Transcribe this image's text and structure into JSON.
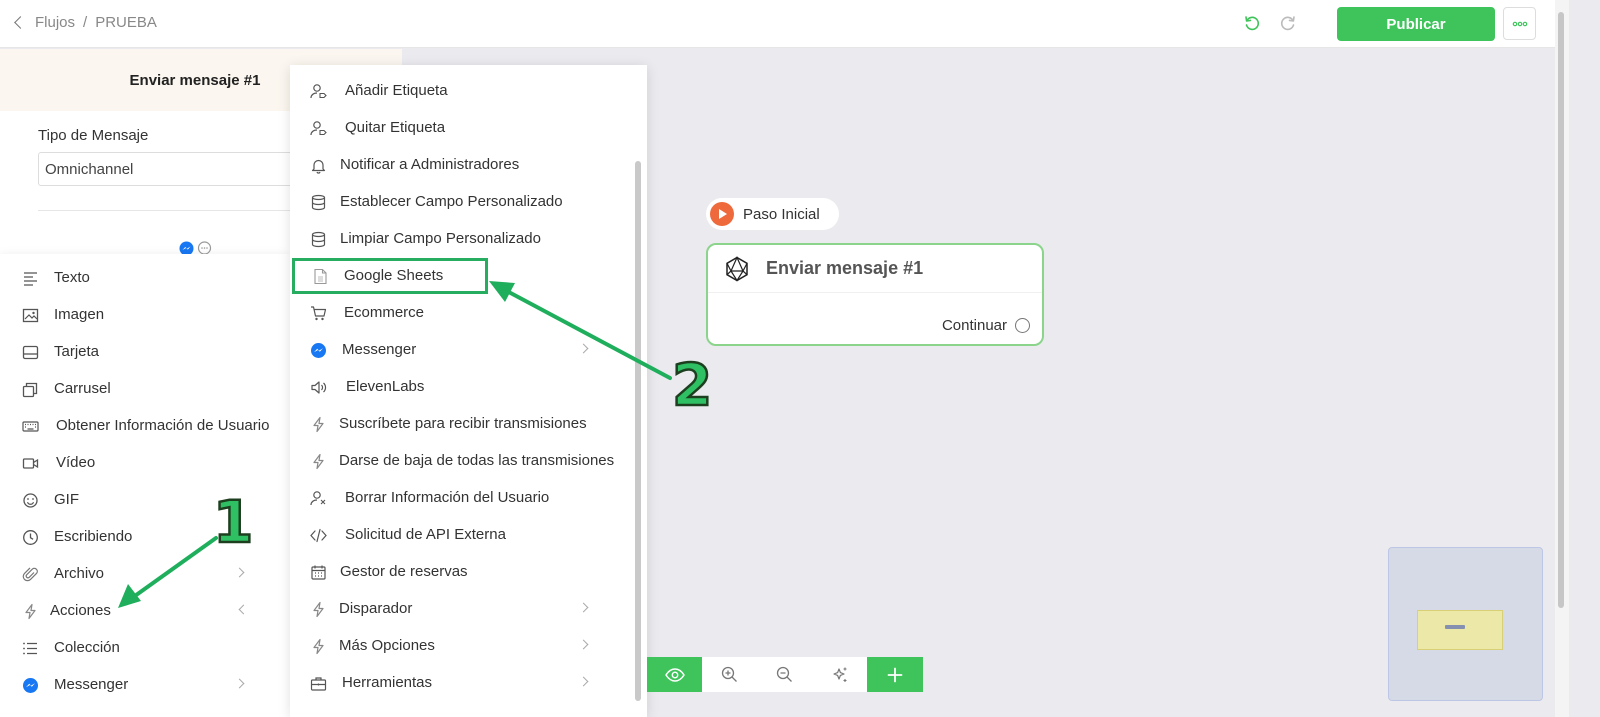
{
  "header": {
    "back_label": "Flujos",
    "separator": "/",
    "current": "PRUEBA",
    "publish_label": "Publicar"
  },
  "editor": {
    "title": "Enviar mensaje #1",
    "type_label": "Tipo de Mensaje",
    "type_value": "Omnichannel"
  },
  "content_menu": {
    "items": [
      {
        "label": "Texto",
        "icon": "text-lines-icon",
        "arrow": "none"
      },
      {
        "label": "Imagen",
        "icon": "image-icon",
        "arrow": "none"
      },
      {
        "label": "Tarjeta",
        "icon": "card-icon",
        "arrow": "none"
      },
      {
        "label": "Carrusel",
        "icon": "carousel-icon",
        "arrow": "none"
      },
      {
        "label": "Obtener Información de Usuario",
        "icon": "keyboard-icon",
        "arrow": "none"
      },
      {
        "label": "Vídeo",
        "icon": "video-icon",
        "arrow": "none"
      },
      {
        "label": "GIF",
        "icon": "smiley-icon",
        "arrow": "none"
      },
      {
        "label": "Escribiendo",
        "icon": "clock-icon",
        "arrow": "none"
      },
      {
        "label": "Archivo",
        "icon": "paperclip-icon",
        "arrow": "right"
      },
      {
        "label": "Acciones",
        "icon": "lightning-icon",
        "arrow": "left"
      },
      {
        "label": "Colección",
        "icon": "list-icon",
        "arrow": "none"
      },
      {
        "label": "Messenger",
        "icon": "messenger-icon",
        "arrow": "right"
      }
    ]
  },
  "actions_menu": {
    "items": [
      {
        "label": "Añadir Etiqueta",
        "icon": "user-tag-icon",
        "arrow": false
      },
      {
        "label": "Quitar Etiqueta",
        "icon": "user-tag-icon",
        "arrow": false
      },
      {
        "label": "Notificar a Administradores",
        "icon": "bell-icon",
        "arrow": false
      },
      {
        "label": "Establecer Campo Personalizado",
        "icon": "database-icon",
        "arrow": false
      },
      {
        "label": "Limpiar Campo Personalizado",
        "icon": "database-icon",
        "arrow": false
      },
      {
        "label": "Google Sheets",
        "icon": "sheet-icon",
        "arrow": false
      },
      {
        "label": "Ecommerce",
        "icon": "cart-icon",
        "arrow": false
      },
      {
        "label": "Messenger",
        "icon": "messenger-icon",
        "arrow": true
      },
      {
        "label": "ElevenLabs",
        "icon": "speaker-icon",
        "arrow": false
      },
      {
        "label": "Suscríbete para recibir transmisiones",
        "icon": "lightning-icon",
        "arrow": false
      },
      {
        "label": "Darse de baja de todas las transmisiones",
        "icon": "lightning-icon",
        "arrow": false
      },
      {
        "label": "Borrar Información del Usuario",
        "icon": "user-remove-icon",
        "arrow": false
      },
      {
        "label": "Solicitud de API Externa",
        "icon": "code-icon",
        "arrow": false
      },
      {
        "label": "Gestor de reservas",
        "icon": "calendar-icon",
        "arrow": false
      },
      {
        "label": "Disparador",
        "icon": "lightning-icon",
        "arrow": true
      },
      {
        "label": "Más Opciones",
        "icon": "lightning-icon",
        "arrow": true
      },
      {
        "label": "Herramientas",
        "icon": "toolbox-icon",
        "arrow": true
      }
    ]
  },
  "canvas": {
    "start_label": "Paso Inicial",
    "node_title": "Enviar mensaje #1",
    "node_continue": "Continuar"
  },
  "annotations": {
    "step1": "1",
    "step2": "2"
  },
  "colors": {
    "accent_green": "#3ec45a",
    "highlight_green": "#27ad5f",
    "start_orange": "#ee6a3c",
    "messenger_blue": "#1877f2"
  }
}
